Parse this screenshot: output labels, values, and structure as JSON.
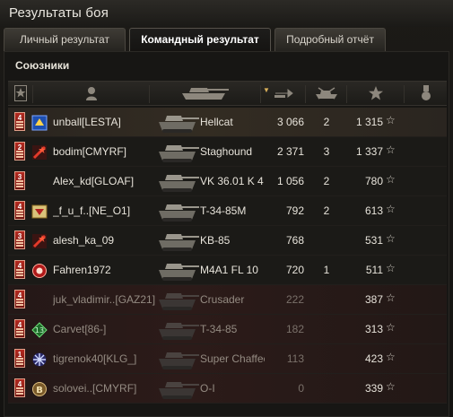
{
  "window": {
    "title": "Результаты боя"
  },
  "tabs": [
    {
      "label": "Личный результат",
      "active": false
    },
    {
      "label": "Командный результат",
      "active": true
    },
    {
      "label": "Подробный отчёт",
      "active": false
    }
  ],
  "team": {
    "title": "Союзники",
    "columns": [
      {
        "id": "rank",
        "icon": "rank-star-icon"
      },
      {
        "id": "player",
        "icon": "player-silhouette-icon"
      },
      {
        "id": "vehicle",
        "icon": "tank-silhouette-icon"
      },
      {
        "id": "damage",
        "icon": "damage-shell-icon",
        "sorted": true
      },
      {
        "id": "kills",
        "icon": "destroyed-tank-icon"
      },
      {
        "id": "xp",
        "icon": "experience-star-icon"
      },
      {
        "id": "medal",
        "icon": "medal-icon"
      }
    ],
    "rows": [
      {
        "rank": "4",
        "player": "unball[LESTA]",
        "clan_icon": "lesta-emblem-icon",
        "vehicle": "Hellcat",
        "damage": "3 066",
        "kills": "2",
        "xp": "1 315",
        "state": "player"
      },
      {
        "rank": "2",
        "player": "bodim[CMYRF]",
        "clan_icon": "red-star-emblem-icon",
        "vehicle": "Staghound",
        "damage": "2 371",
        "kills": "3",
        "xp": "1 337",
        "state": "alive"
      },
      {
        "rank": "3",
        "player": "Alex_kd[GLOAF]",
        "clan_icon": "",
        "vehicle": "VK 36.01 K 4",
        "damage": "1 056",
        "kills": "2",
        "xp": "780",
        "state": "alive"
      },
      {
        "rank": "4",
        "player": "_f_u_f..[NE_O1]",
        "clan_icon": "gerb-emblem-icon",
        "vehicle": "T-34-85M",
        "damage": "792",
        "kills": "2",
        "xp": "613",
        "state": "alive"
      },
      {
        "rank": "3",
        "player": "alesh_ka_09",
        "clan_icon": "red-star-emblem-icon",
        "vehicle": "KB-85",
        "damage": "768",
        "kills": "",
        "xp": "531",
        "state": "alive"
      },
      {
        "rank": "4",
        "player": "Fahren1972",
        "clan_icon": "red-circle-emblem-icon",
        "vehicle": "M4A1 FL 10",
        "damage": "720",
        "kills": "1",
        "xp": "511",
        "state": "alive"
      },
      {
        "rank": "4",
        "player": "juk_vladimir..[GAZ21]",
        "clan_icon": "",
        "vehicle": "Crusader",
        "damage": "222",
        "kills": "",
        "xp": "387",
        "state": "dead"
      },
      {
        "rank": "4",
        "player": "Carvet[86-]",
        "clan_icon": "green-13-emblem-icon",
        "vehicle": "T-34-85",
        "damage": "182",
        "kills": "",
        "xp": "313",
        "state": "dead"
      },
      {
        "rank": "1",
        "player": "tigrenok40[KLG_]",
        "clan_icon": "snowflake-emblem-icon",
        "vehicle": "Super Chaffee",
        "damage": "113",
        "kills": "",
        "xp": "423",
        "state": "dead"
      },
      {
        "rank": "4",
        "player": "solovei..[CMYRF]",
        "clan_icon": "bronze-b-emblem-icon",
        "vehicle": "O-I",
        "damage": "0",
        "kills": "",
        "xp": "339",
        "state": "dead"
      }
    ]
  },
  "icons": {
    "star": "☆"
  },
  "colors": {
    "accent": "#d9b05a",
    "rank_red": "#b42a20",
    "dead_text": "#948b82"
  }
}
